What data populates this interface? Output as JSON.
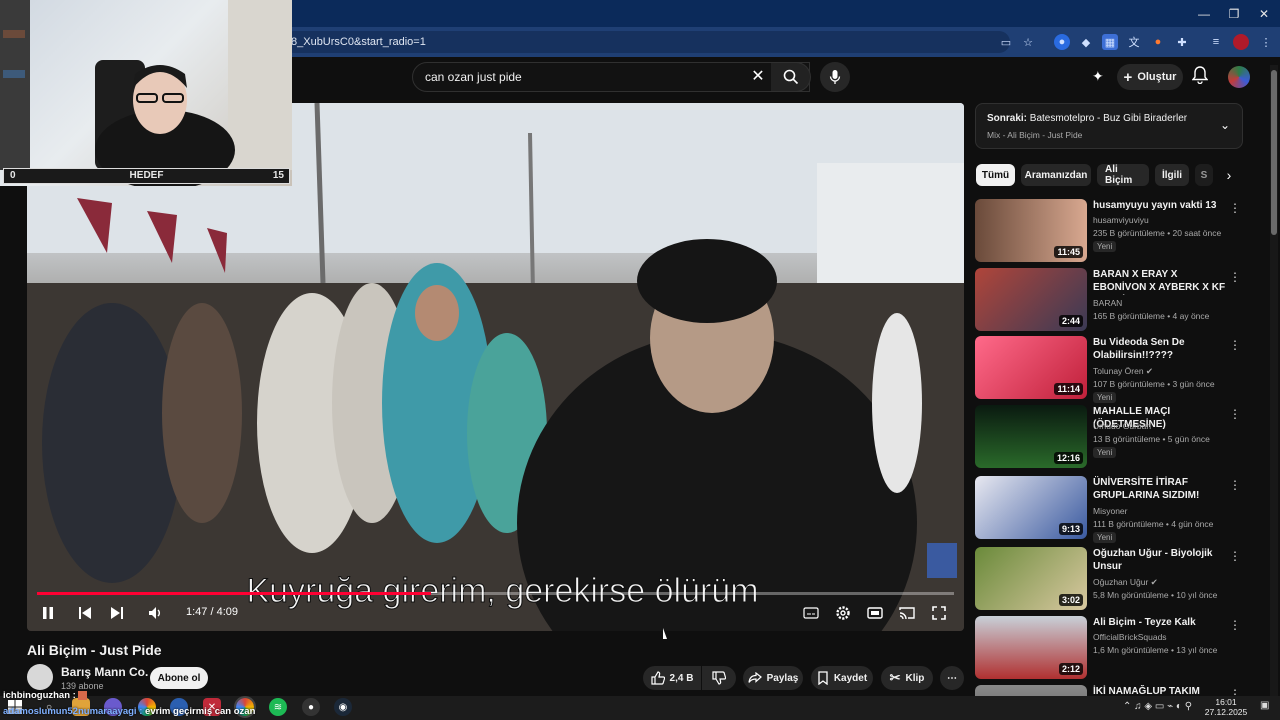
{
  "browser": {
    "url": "8_XubUrsC0&start_radio=1",
    "window_controls": [
      "—",
      "❐",
      "✕"
    ]
  },
  "youtube": {
    "search_value": "can ozan just pide",
    "create_label": "Oluştur",
    "video": {
      "subtitle": "Kuyruğa girerim, gerekirse ölürüm",
      "progress": 0.43,
      "time": "1:47 / 4:09",
      "title": "Ali Biçim - Just Pide"
    },
    "channel": {
      "name": "Barış Mann Co.",
      "subs": "139 abone",
      "subscribe_label": "Abone ol"
    },
    "actions": {
      "likes": "2,4 B",
      "share": "Paylaş",
      "save": "Kaydet",
      "clip": "Klip"
    },
    "next": {
      "label": "Sonraki:",
      "title": "Batesmotelpro - Buz Gibi Biraderler",
      "sub": "Mix - Ali Biçim - Just Pide"
    },
    "chips": [
      "Tümü",
      "Aramanızdan",
      "Ali Biçim",
      "İlgili",
      "S"
    ],
    "items": [
      {
        "title": "husamyuyu yayın vakti 13",
        "channel": "husamviyuviyu",
        "meta": "235 B görüntüleme • 20 saat önce",
        "badge": "Yeni",
        "duration": "11:45",
        "verified": false
      },
      {
        "title": "BARAN X ERAY X EBONİVON X AYBERK X KF -KATLİFEST ...",
        "channel": "BARAN",
        "meta": "165 B görüntüleme • 4 ay önce",
        "badge": "",
        "duration": "2:44",
        "verified": false
      },
      {
        "title": "Bu Videoda Sen De Olabilirsin!!????",
        "channel": "Tolunay Ören",
        "meta": "107 B görüntüleme • 3 gün önce",
        "badge": "Yeni",
        "duration": "11:14",
        "verified": true
      },
      {
        "title": "MAHALLE MAÇI (ÖDETMESİNE)",
        "channel": "Umudo Gurban",
        "meta": "13 B görüntüleme • 5 gün önce",
        "badge": "Yeni",
        "duration": "12:16",
        "verified": false
      },
      {
        "title": "ÜNİVERSİTE İTİRAF GRUPLARINA SIZDIM! (Ortalık...",
        "channel": "Misyoner",
        "meta": "111 B görüntüleme • 4 gün önce",
        "badge": "Yeni",
        "duration": "9:13",
        "verified": false
      },
      {
        "title": "Oğuzhan Uğur - Biyolojik Unsur",
        "channel": "Oğuzhan Uğur",
        "meta": "5,8 Mn görüntüleme • 10 yıl önce",
        "badge": "",
        "duration": "3:02",
        "verified": true
      },
      {
        "title": "Ali Biçim - Teyze Kalk",
        "channel": "OfficialBrickSquads",
        "meta": "1,6 Mn görüntüleme • 13 yıl önce",
        "badge": "",
        "duration": "2:12",
        "verified": false
      },
      {
        "title": "İKİ NAMAĞLUP TAKIM KARŞI",
        "channel": "",
        "meta": "",
        "badge": "",
        "duration": "",
        "verified": false
      }
    ]
  },
  "overlay": {
    "goal_left": "0",
    "goal_label": "HEDEF",
    "goal_right": "15",
    "chat": [
      {
        "user": "ichbinoguzhan :",
        "text": ""
      },
      {
        "user": "adamoslumun52numaraayagi :",
        "text": "evrim geçirmiş can ozan"
      }
    ]
  },
  "taskbar": {
    "time": "16:01",
    "date": "27.12.2025"
  }
}
